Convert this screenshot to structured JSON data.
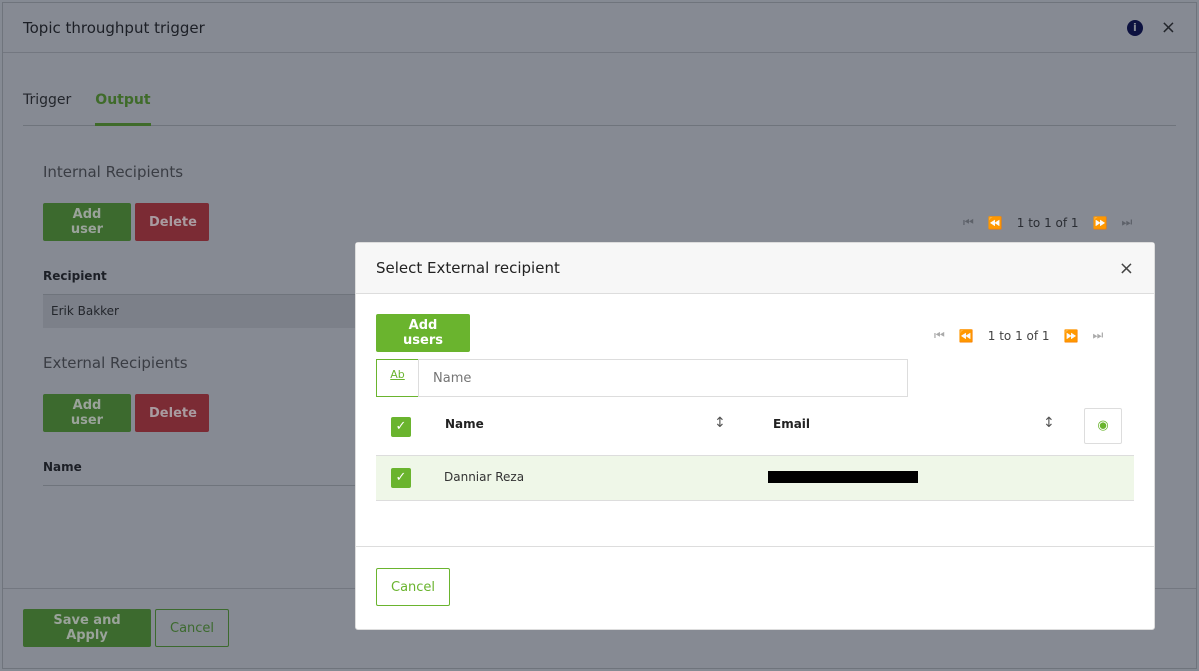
{
  "dialog": {
    "title": "Topic throughput trigger",
    "tabs": [
      {
        "label": "Trigger"
      },
      {
        "label": "Output"
      }
    ],
    "internal": {
      "title": "Internal Recipients",
      "add": "Add user",
      "delete": "Delete",
      "col": "Recipient",
      "rows": [
        "Erik Bakker"
      ],
      "pagination": "1 to 1 of 1"
    },
    "external": {
      "title": "External Recipients",
      "add": "Add user",
      "delete": "Delete",
      "col": "Name"
    },
    "save": "Save and Apply",
    "cancel": "Cancel"
  },
  "modal": {
    "title": "Select External recipient",
    "add": "Add users",
    "pagination": "1 to 1 of 1",
    "filter_icon": "Ab",
    "filter_placeholder": "Name",
    "columns": [
      "Name",
      "Email"
    ],
    "rows": [
      {
        "name": "Danniar Reza",
        "email_redacted": true,
        "checked": true
      }
    ],
    "cancel": "Cancel"
  },
  "colors": {
    "accent": "#6ab42e",
    "danger": "#d9424e"
  }
}
